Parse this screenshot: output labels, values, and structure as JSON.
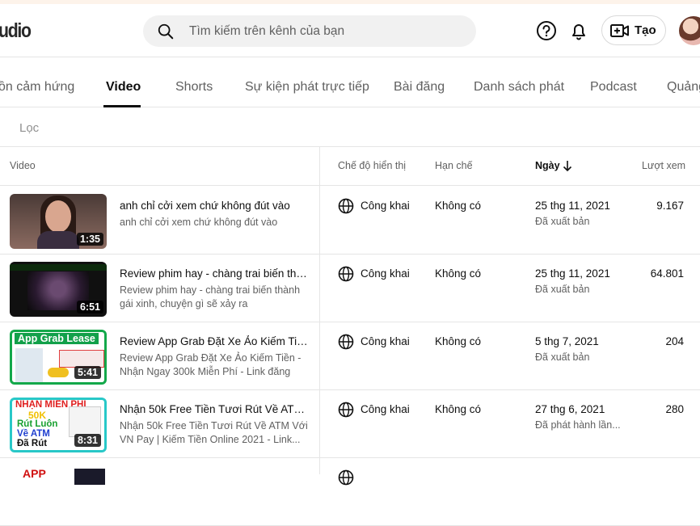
{
  "header": {
    "logo_text": "udio",
    "search_placeholder": "Tìm kiếm trên kênh của bạn",
    "create_label": "Tạo"
  },
  "tabs": [
    {
      "label": "ồn cảm hứng",
      "active": false
    },
    {
      "label": "Video",
      "active": true
    },
    {
      "label": "Shorts",
      "active": false
    },
    {
      "label": "Sự kiện phát trực tiếp",
      "active": false
    },
    {
      "label": "Bài đăng",
      "active": false
    },
    {
      "label": "Danh sách phát",
      "active": false
    },
    {
      "label": "Podcast",
      "active": false
    },
    {
      "label": "Quảng",
      "active": false
    }
  ],
  "filter": {
    "label": "Lọc"
  },
  "columns": {
    "video": "Video",
    "visibility": "Chế độ hiển thị",
    "restrictions": "Hạn chế",
    "date": "Ngày",
    "views": "Lượt xem"
  },
  "rows": [
    {
      "title": "anh chỉ cởi xem chứ không đút vào",
      "desc": "anh chỉ cởi xem chứ không đút vào",
      "duration": "1:35",
      "visibility": "Công khai",
      "restriction": "Không có",
      "date": "25 thg 11, 2021",
      "status": "Đã xuất bản",
      "views": "9.167"
    },
    {
      "title": "Review phim hay - chàng trai biến thàn...",
      "desc": "Review phim hay - chàng trai biến thành gái xinh, chuyện gì sẽ xảy ra",
      "duration": "6:51",
      "visibility": "Công khai",
      "restriction": "Không có",
      "date": "25 thg 11, 2021",
      "status": "Đã xuất bản",
      "views": "64.801"
    },
    {
      "title": "Review App Grab Đặt Xe Ảo Kiếm Tiền...",
      "desc": "Review App Grab Đặt Xe Ảo Kiếm Tiền - Nhận Ngay 300k Miễn Phí - Link đăng kí:...",
      "duration": "5:41",
      "visibility": "Công khai",
      "restriction": "Không có",
      "date": "5 thg 7, 2021",
      "status": "Đã xuất bản",
      "views": "204",
      "thumb_text": "App Grab Lease"
    },
    {
      "title": "Nhận 50k Free Tiền Tươi Rút Về ATM ...",
      "desc": "Nhận 50k Free Tiền Tươi Rút Về ATM Với VN Pay | Kiếm Tiền Online 2021 - Link...",
      "duration": "8:31",
      "visibility": "Công khai",
      "restriction": "Không có",
      "date": "27 thg 6, 2021",
      "status": "Đã phát hành lần...",
      "views": "280",
      "thumb_lines": [
        "NHẬN MIỄN PHÍ",
        "50K",
        "Rút Luôn",
        "Về ATM",
        "Đã Rút"
      ]
    },
    {
      "thumb_text": "APP"
    }
  ]
}
